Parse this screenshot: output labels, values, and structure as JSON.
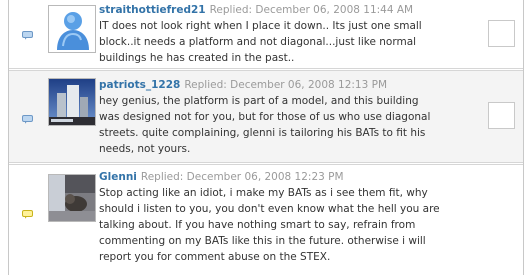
{
  "comments": [
    {
      "author": "straithottiefred21",
      "replied": "Replied: December 06, 2008 11:44 AM",
      "lines": [
        "IT does not look right when I place it down.. Its just one small",
        "block..it needs a platform and not diagonal...just like normal",
        "buildings he has created in the past.."
      ]
    },
    {
      "author": "patriots_1228",
      "replied": "Replied: December 06, 2008 12:13 PM",
      "lines": [
        "hey genius, the platform is part of a model, and this building",
        "was designed not for you, but for those of us who use diagonal",
        "streets. quite complaining, glenni is tailoring his BATs to fit his",
        "needs, not yours."
      ]
    },
    {
      "author": "Glenni",
      "replied": "Replied: December 06, 2008 12:23 PM",
      "lines": [
        "Stop acting like an idiot, i make my BATs as i see them fit, why",
        "should i listen to you, you don't even know what the hell you are",
        "talking about. If you have nothing smart to say, refrain from",
        "commenting on my BATs like this in the future. otherwise i will",
        "report you for comment abuse on the STEX."
      ]
    }
  ],
  "colors": {
    "author": "#3373a8",
    "replied": "#9a9a9a",
    "text": "#333333",
    "bubble_blue": "#7fa9d6",
    "bubble_yellow": "#e8d94a"
  },
  "icons": {
    "comment_bubble": "speech-bubble-icon"
  }
}
